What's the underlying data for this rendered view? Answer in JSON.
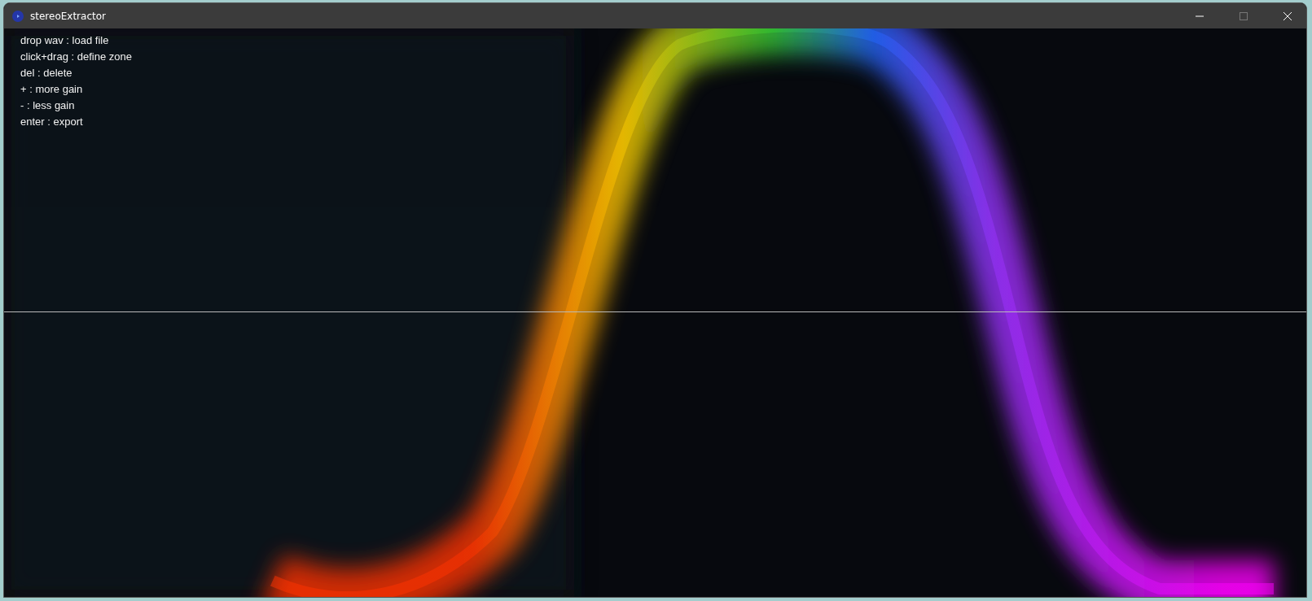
{
  "window": {
    "title": "stereoExtractor"
  },
  "help_lines": [
    "drop wav : load file",
    "click+drag : define zone",
    "del : delete",
    "+ : more gain",
    "- : less gain",
    "enter : export"
  ]
}
